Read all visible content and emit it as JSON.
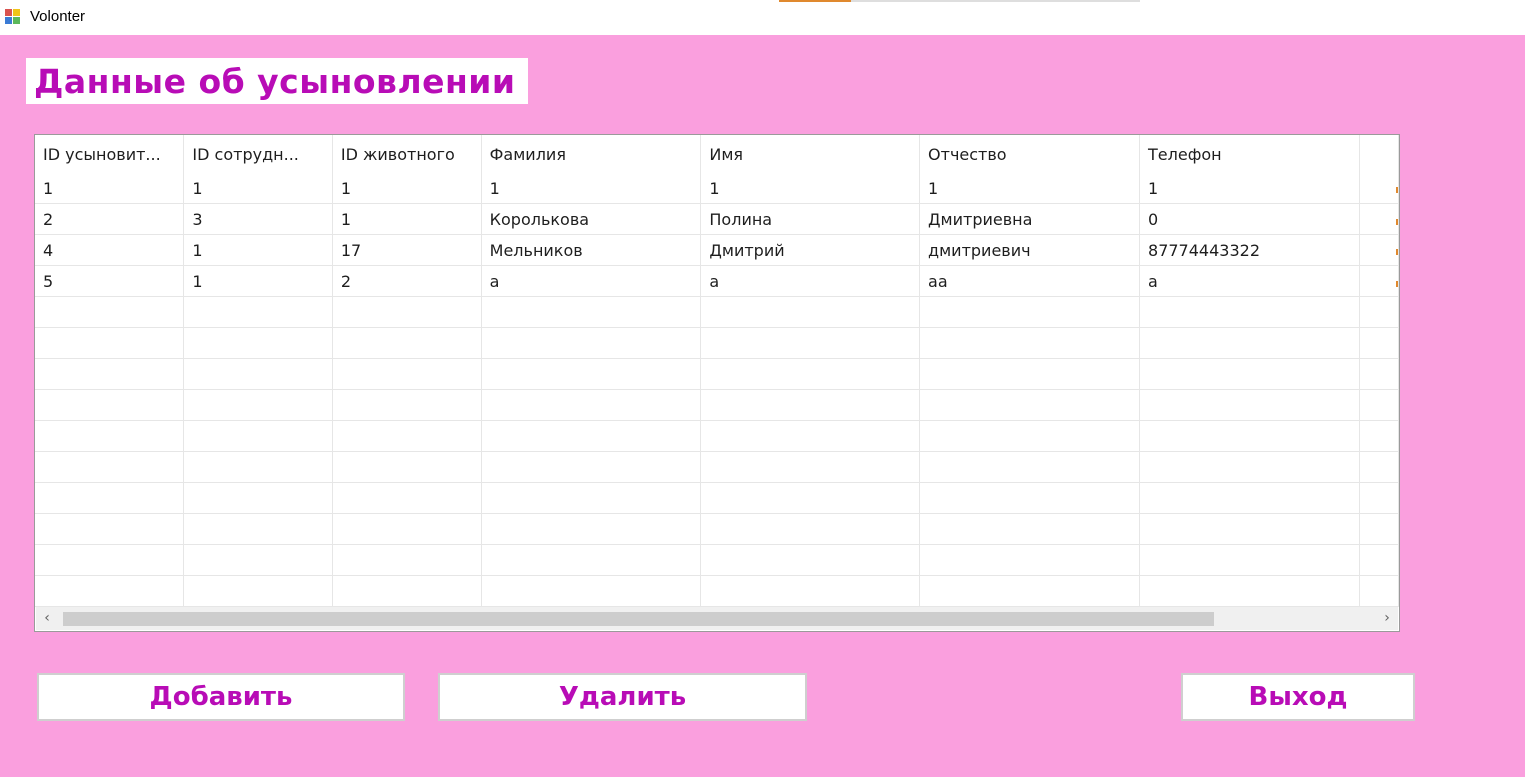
{
  "window": {
    "title": "Volonter"
  },
  "form": {
    "heading": "Данные об усыновлении",
    "background_color": "#fa9fde",
    "accent_color": "#b80cb6"
  },
  "grid": {
    "columns": [
      "ID усыновит...",
      "ID сотрудн...",
      "ID животного",
      "Фамилия",
      "Имя",
      "Отчество",
      "Телефон"
    ],
    "rows": [
      [
        "1",
        "1",
        "1",
        "1",
        "1",
        "1",
        "1"
      ],
      [
        "2",
        "3",
        "1",
        "Королькова",
        "Полина",
        "Дмитриевна",
        "0"
      ],
      [
        "4",
        "1",
        "17",
        "Мельников",
        "Дмитрий",
        "дмитриевич",
        "87774443322"
      ],
      [
        "5",
        "1",
        "2",
        "а",
        "а",
        "аа",
        "а"
      ]
    ]
  },
  "scrollbar": {
    "left_icon": "chevron-left-icon",
    "right_icon": "chevron-right-icon",
    "left_glyph": "‹",
    "right_glyph": "›"
  },
  "buttons": {
    "add": "Добавить",
    "delete": "Удалить",
    "exit": "Выход"
  }
}
